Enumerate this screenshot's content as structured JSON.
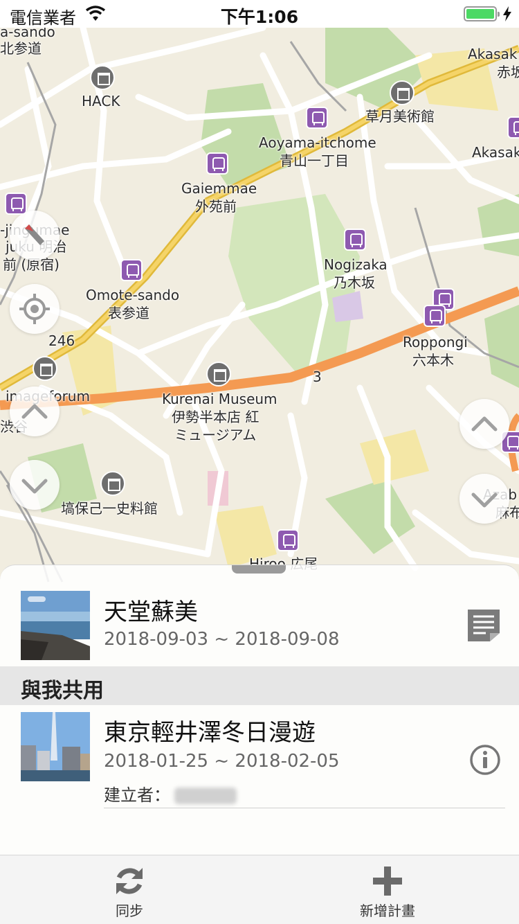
{
  "status_bar": {
    "carrier": "電信業者",
    "time": "下午1:06",
    "battery_level": 1.0
  },
  "map": {
    "labels": [
      {
        "name": "map-label-omotesando-top",
        "text": "a-sando"
      },
      {
        "name": "map-label-kitasando",
        "text": "北参道"
      },
      {
        "name": "map-label-hack",
        "text": "HACK"
      },
      {
        "name": "map-label-akasaka-top",
        "text": "Akasak"
      },
      {
        "name": "map-label-akasaka-jp",
        "text": "赤坂"
      },
      {
        "name": "map-label-sogetsu",
        "text": "草月美術館"
      },
      {
        "name": "map-label-aoyama-itchome",
        "text": "Aoyama-itchome"
      },
      {
        "name": "map-label-aoyama-itchome-jp",
        "text": "青山一丁目"
      },
      {
        "name": "map-label-akasaka-2",
        "text": "Akasak"
      },
      {
        "name": "map-label-gaiemmae",
        "text": "Gaiemmae"
      },
      {
        "name": "map-label-gaiemmae-jp",
        "text": "外苑前"
      },
      {
        "name": "map-label-jingumae",
        "text": "-jingumae"
      },
      {
        "name": "map-label-harajuku",
        "text": "juku 明治"
      },
      {
        "name": "map-label-harajuku-jp",
        "text": "前 (原宿)"
      },
      {
        "name": "map-label-nogizaka",
        "text": "Nogizaka"
      },
      {
        "name": "map-label-nogizaka-jp",
        "text": "乃木坂"
      },
      {
        "name": "map-label-omotesando",
        "text": "Omote-sando"
      },
      {
        "name": "map-label-omotesando-jp",
        "text": "表参道"
      },
      {
        "name": "map-label-route-246",
        "text": "246"
      },
      {
        "name": "map-label-roppongi",
        "text": "Roppongi"
      },
      {
        "name": "map-label-roppongi-jp",
        "text": "六本木"
      },
      {
        "name": "map-label-route-3",
        "text": "3"
      },
      {
        "name": "map-label-imageforum",
        "text": "imageforum"
      },
      {
        "name": "map-label-kurenai",
        "text": "Kurenai Museum"
      },
      {
        "name": "map-label-kurenai-jp-1",
        "text": "伊勢半本店 紅"
      },
      {
        "name": "map-label-kurenai-jp-2",
        "text": "ミュージアム"
      },
      {
        "name": "map-label-shibuya",
        "text": "渋谷"
      },
      {
        "name": "map-label-azabu",
        "text": "Azab"
      },
      {
        "name": "map-label-azabu-jp",
        "text": "麻布"
      },
      {
        "name": "map-label-hanawa",
        "text": "塙保己一史料館"
      },
      {
        "name": "map-label-hiroo",
        "text": "Hiroo 広尾"
      }
    ]
  },
  "sheet": {
    "my_trip": {
      "title": "天堂蘇美",
      "dates": "2018-09-03 ~ 2018-09-08"
    },
    "shared_header": "與我共用",
    "shared_trip": {
      "title": "東京輕井澤冬日漫遊",
      "dates": "2018-01-25 ~ 2018-02-05",
      "creator_label": "建立者："
    }
  },
  "tab_bar": {
    "sync_label": "同步",
    "new_plan_label": "新增計畫"
  },
  "colors": {
    "map_bg": "#f1ede0",
    "park": "#c7dfae",
    "major_road": "#f5a05c",
    "highway": "#f2c94c",
    "station_pin": "#8e5ab0",
    "battery": "#4cd964"
  }
}
